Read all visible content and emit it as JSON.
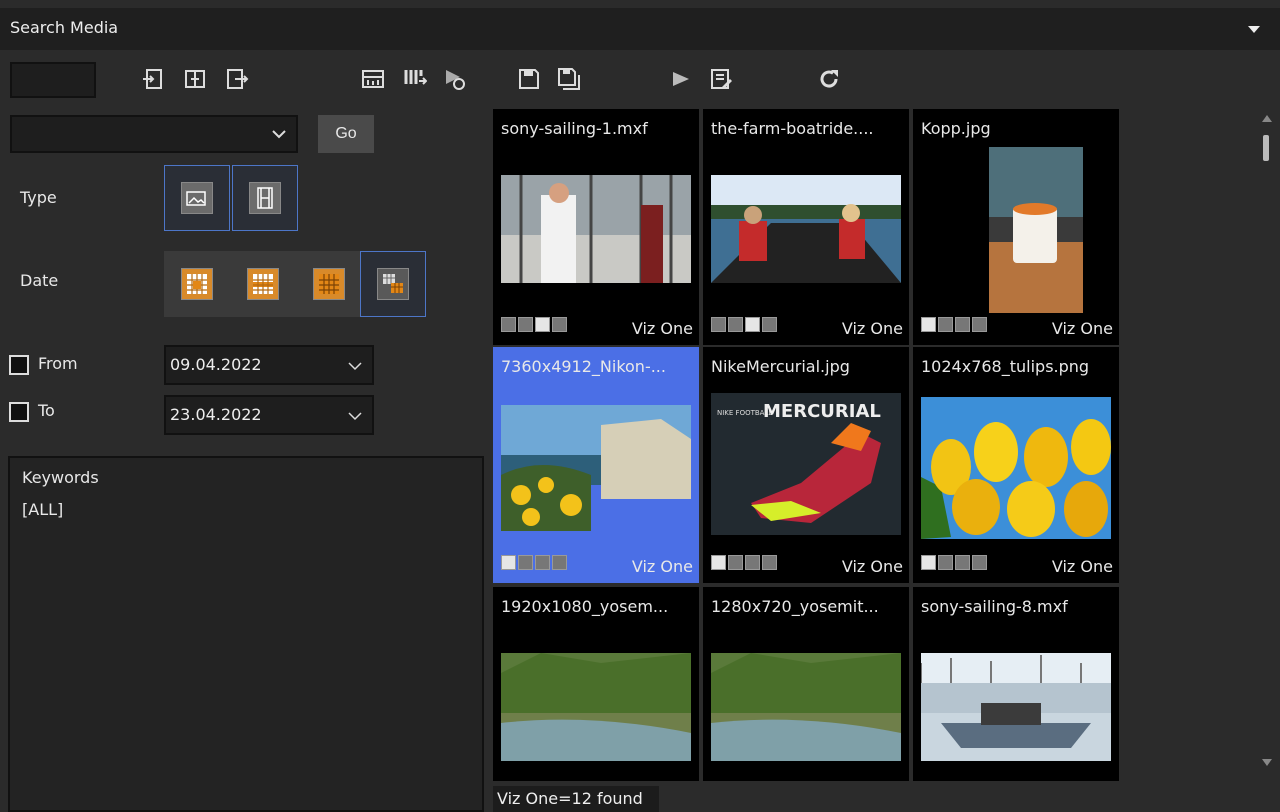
{
  "panel": {
    "title": "Search Media"
  },
  "toolbar": {
    "search_value": "",
    "icons": [
      "import-icon",
      "split-icon",
      "export-icon",
      "add-layer-icon",
      "queue-icon",
      "schedule-icon",
      "save-icon",
      "save-all-icon",
      "play-icon",
      "edit-list-icon",
      "refresh-icon"
    ]
  },
  "filters": {
    "go_label": "Go",
    "type_label": "Type",
    "date_label": "Date",
    "from_label": "From",
    "from_value": "09.04.2022",
    "to_label": "To",
    "to_value": "23.04.2022"
  },
  "keywords": {
    "header": "Keywords",
    "value": "[ALL]"
  },
  "results": [
    {
      "name": "sony-sailing-1.mxf",
      "source": "Viz One",
      "kind": "video",
      "selected": false,
      "thumb": "sailing"
    },
    {
      "name": "the-farm-boatride....",
      "source": "Viz One",
      "kind": "video",
      "selected": false,
      "thumb": "boatride"
    },
    {
      "name": "Kopp.jpg",
      "source": "Viz One",
      "kind": "image",
      "selected": false,
      "thumb": "cup"
    },
    {
      "name": "7360x4912_Nikon-...",
      "source": "Viz One",
      "kind": "image",
      "selected": true,
      "thumb": "cliff"
    },
    {
      "name": "NikeMercurial.jpg",
      "source": "Viz One",
      "kind": "image",
      "selected": false,
      "thumb": "shoe"
    },
    {
      "name": "1024x768_tulips.png",
      "source": "Viz One",
      "kind": "image",
      "selected": false,
      "thumb": "tulips"
    },
    {
      "name": "1920x1080_yosem...",
      "source": "",
      "kind": "image",
      "selected": false,
      "thumb": "yosemite"
    },
    {
      "name": "1280x720_yosemit...",
      "source": "",
      "kind": "image",
      "selected": false,
      "thumb": "yosemite"
    },
    {
      "name": "sony-sailing-8.mxf",
      "source": "",
      "kind": "video",
      "selected": false,
      "thumb": "marina"
    }
  ],
  "thumb_text": {
    "shoe_brand": "MERCURIAL",
    "shoe_small": "NIKE FOOTBALL"
  },
  "status": {
    "text": "Viz One=12 found"
  }
}
